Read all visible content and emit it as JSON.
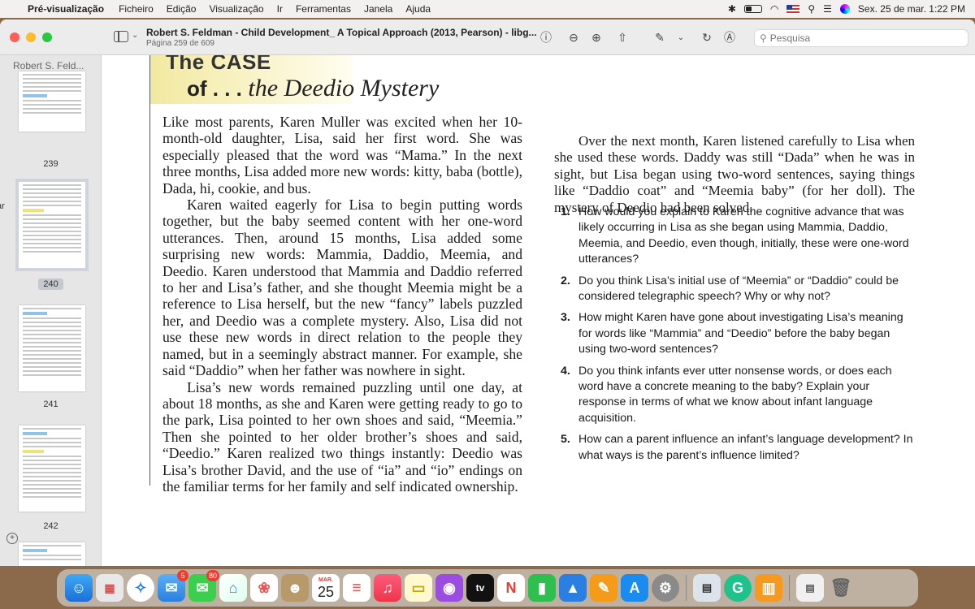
{
  "menubar": {
    "app_name": "Pré-visualização",
    "items": [
      "Ficheiro",
      "Edição",
      "Visualização",
      "Ir",
      "Ferramentas",
      "Janela",
      "Ajuda"
    ],
    "datetime": "Sex. 25 de mar.  1:22 PM"
  },
  "window": {
    "title": "Robert S. Feldman - Child Development_ A Topical Approach (2013, Pearson) - libg...",
    "subtitle": "Página 259 de 609",
    "search_placeholder": "Pesquisa"
  },
  "sidebar": {
    "title": "Robert S. Feld...",
    "edge_text": "ar",
    "pages": [
      "239",
      "240",
      "241",
      "242"
    ],
    "selected_page": "240"
  },
  "document": {
    "heading_case": "The CASE",
    "heading_of": "of . . .",
    "heading_title": "the Deedio Mystery",
    "left_paragraphs": [
      "Like most parents, Karen Muller was excited when her 10-month-old daughter, Lisa, said her first word. She was especially pleased that the word was “Mama.” In the next three months, Lisa added more new words: kitty, baba (bottle), Dada, hi, cookie, and bus.",
      "Karen waited eagerly for Lisa to begin putting words together, but the baby seemed content with her one-word utterances. Then, around 15 months, Lisa added some surprising new words: Mammia, Daddio, Meemia, and Deedio. Karen understood that Mammia and Daddio referred to her and Lisa’s father, and she thought Meemia might be a reference to Lisa herself, but the new “fancy” labels puzzled her, and Deedio was a complete mystery. Also, Lisa did not use these new words in direct relation to the people they named, but in a seemingly abstract manner. For example, she said “Daddio” when her father was nowhere in sight.",
      "Lisa’s new words remained puzzling until one day, at about 18 months, as she and Karen were getting ready to go to the park, Lisa pointed to her own shoes and said, “Meemia.” Then she pointed to her older brother’s shoes and said, “Deedio.” Karen realized two things instantly: Deedio was Lisa’s brother David, and the use of “ia” and “io” endings on the familiar terms for her family and self indicated ownership."
    ],
    "right_paragraph": "Over the next month, Karen listened carefully to Lisa when she used these words. Daddy was still “Dada” when he was in sight, but Lisa began using two-word sentences, saying things like “Daddio coat” and “Meemia baby” (for her doll). The mystery of Deedio had been solved.",
    "questions": [
      {
        "n": "1.",
        "text": "How would you explain to Karen the cognitive advance that was likely occurring in Lisa as she began using Mammia, Daddio, Meemia, and Deedio, even though, initially, these were one-word utterances?"
      },
      {
        "n": "2.",
        "text": "Do you think Lisa’s initial use of “Meemia” or “Daddio” could be considered telegraphic speech? Why or why not?"
      },
      {
        "n": "3.",
        "text": "How might Karen have gone about investigating Lisa’s meaning for words like “Mammia” and “Deedio” before the baby began using two-word sentences?"
      },
      {
        "n": "4.",
        "text": "Do you think infants ever utter nonsense words, or does each word have a concrete meaning to the baby? Explain your response in terms of what we know about infant language acquisition."
      },
      {
        "n": "5.",
        "text": "How can a parent influence an infant’s language development? In what ways is the parent’s influence limited?"
      }
    ]
  },
  "dock": {
    "mail_badge": "5",
    "messages_badge": "80",
    "calendar_month": "MAR.",
    "calendar_day": "25",
    "tv_label": "tv"
  },
  "colors": {
    "menubar_bg": "#f3f1ef",
    "sidebar_bg": "#e6e6e6",
    "heading_band": "#f2e9a0"
  }
}
